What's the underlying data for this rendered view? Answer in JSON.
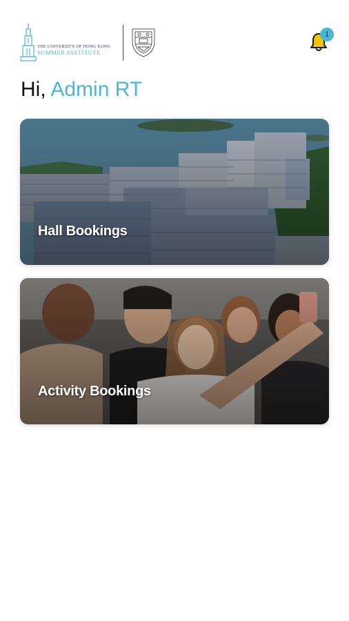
{
  "header": {
    "logo": {
      "line1": "THE UNIVERSITY OF HONG KONG",
      "line2": "SUMMER INSTITUTE"
    },
    "notifications": {
      "icon": "bell-icon",
      "count": "1"
    }
  },
  "greeting": {
    "prefix": "Hi,",
    "name": "Admin RT"
  },
  "cards": [
    {
      "title": "Hall Bookings"
    },
    {
      "title": "Activity Bookings"
    }
  ],
  "colors": {
    "accent": "#4ab7d9",
    "bell": "#f5c400"
  }
}
